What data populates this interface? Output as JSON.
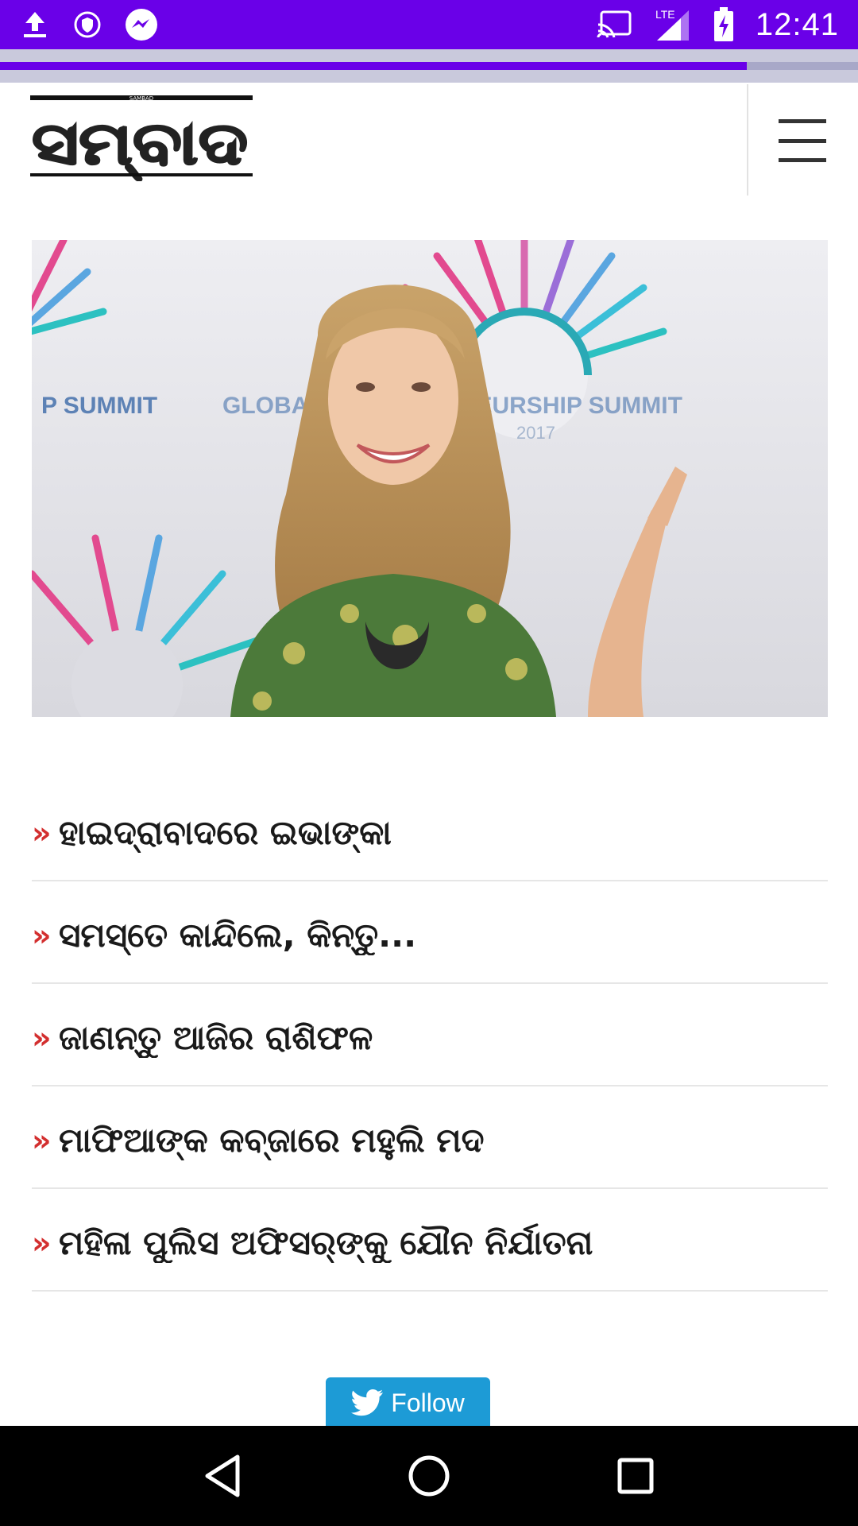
{
  "status_bar": {
    "time": "12:41",
    "network": "LTE",
    "icons": [
      "upload-icon",
      "vpn-shield-icon",
      "messenger-icon",
      "cast-icon",
      "signal-icon",
      "battery-charging-icon"
    ]
  },
  "page_load_progress": 0.87,
  "header": {
    "logo_small_text": "SAMBAD",
    "logo_text": "ସମ୍ବାଦ",
    "menu_icon": "hamburger-menu-icon"
  },
  "hero": {
    "banner_text": "GLOBAL ENTREPRENEURSHIP SUMMIT",
    "banner_left_text": "P SUMMIT",
    "year": "2017"
  },
  "news": [
    {
      "title": "ହାଇଦ୍ରାବାଦରେ ଇଭାଙ୍କା"
    },
    {
      "title": "ସମସ୍ତେ କାନ୍ଦିଲେ, କିନ୍ତୁ..."
    },
    {
      "title": "ଜାଣନ୍ତୁ ଆଜିର ରାଶିଫଳ"
    },
    {
      "title": "ମାଫିଆଙ୍କ କବ୍ଜାରେ ମହୁଲି ମଦ"
    },
    {
      "title": "ମହିଳା ପୁଲିସ ଅଫିସର୍‌ଙ୍କୁ ଯୌନ ନିର୍ଯାତନା"
    }
  ],
  "news_marker": "»",
  "follow": {
    "label": "Follow",
    "icon": "twitter-bird-icon",
    "color": "#1d9bd6"
  },
  "colors": {
    "status_bar": "#6a00e8",
    "accent_arrow": "#d32f2f"
  },
  "nav": {
    "icons": [
      "back-icon",
      "home-icon",
      "recents-icon"
    ]
  }
}
